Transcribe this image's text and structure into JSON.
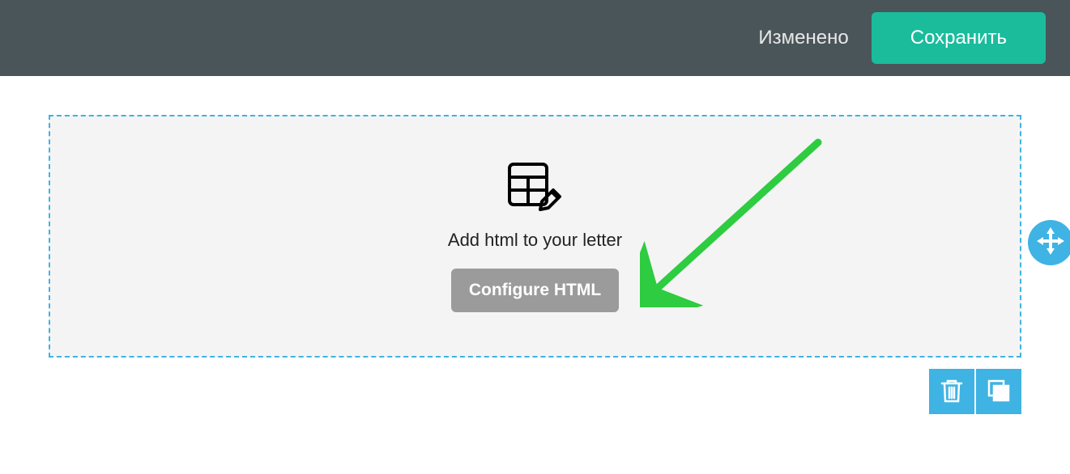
{
  "topbar": {
    "status_text": "Изменено",
    "save_label": "Сохранить"
  },
  "block": {
    "description": "Add html to your letter",
    "configure_label": "Configure HTML"
  },
  "colors": {
    "topbar_bg": "#4a5559",
    "primary_button": "#1abc9c",
    "accent": "#3fb3e3",
    "block_bg": "#f4f4f4",
    "secondary_button": "#9b9b9b",
    "arrow": "#2ecc40"
  }
}
